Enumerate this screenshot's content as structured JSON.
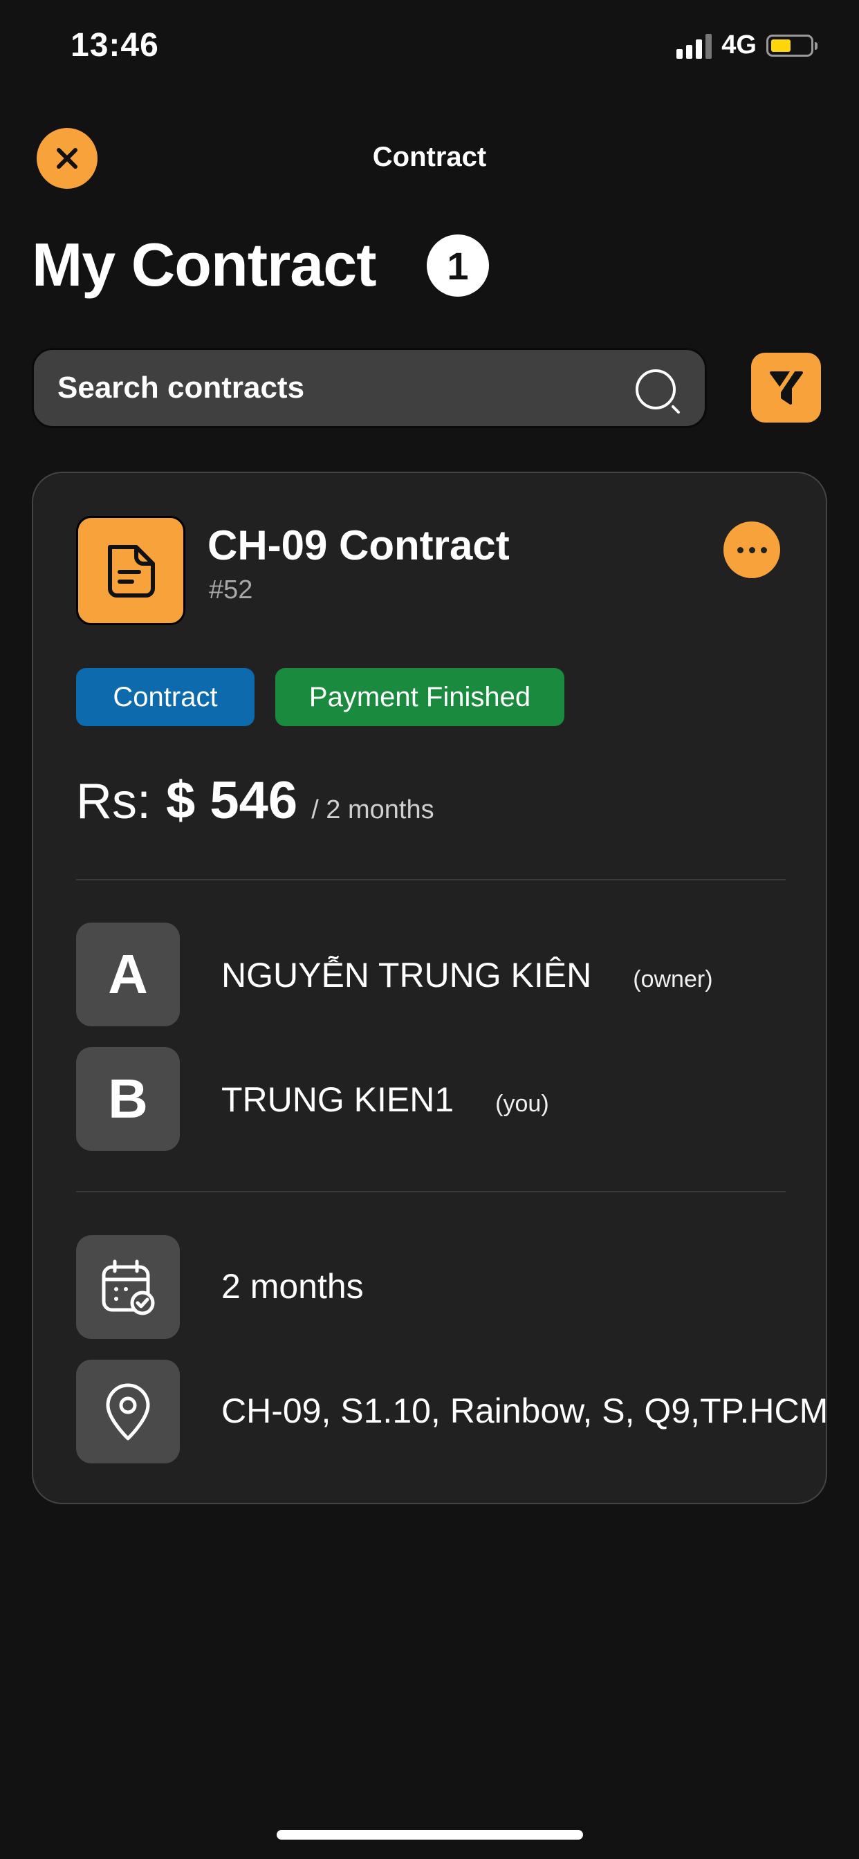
{
  "status_bar": {
    "time": "13:46",
    "network": "4G"
  },
  "header": {
    "title": "Contract",
    "close_icon": "close-icon"
  },
  "page": {
    "title": "My Contract",
    "count": "1"
  },
  "search": {
    "placeholder": "Search contracts",
    "icon": "search-icon"
  },
  "filter": {
    "icon": "filter-icon"
  },
  "contract": {
    "icon": "document-icon",
    "title": "CH-09 Contract",
    "id": "#52",
    "tags": [
      "Contract",
      "Payment Finished"
    ],
    "price": {
      "currency": "Rs:",
      "amount": "$ 546",
      "period": "/ 2 months"
    },
    "parties": [
      {
        "initial": "A",
        "name": "NGUYỄN TRUNG KIÊN",
        "role": "(owner)"
      },
      {
        "initial": "B",
        "name": "TRUNG KIEN1",
        "role": "(you)"
      }
    ],
    "duration": "2 months",
    "address": "CH-09, S1.10, Rainbow, S, Q9,TP.HCM"
  },
  "colors": {
    "accent": "#f7a23a",
    "background": "#121212",
    "card": "#212121",
    "tag_contract": "#0d6aad",
    "tag_status": "#1a8a3e",
    "battery": "#ffd60a"
  }
}
